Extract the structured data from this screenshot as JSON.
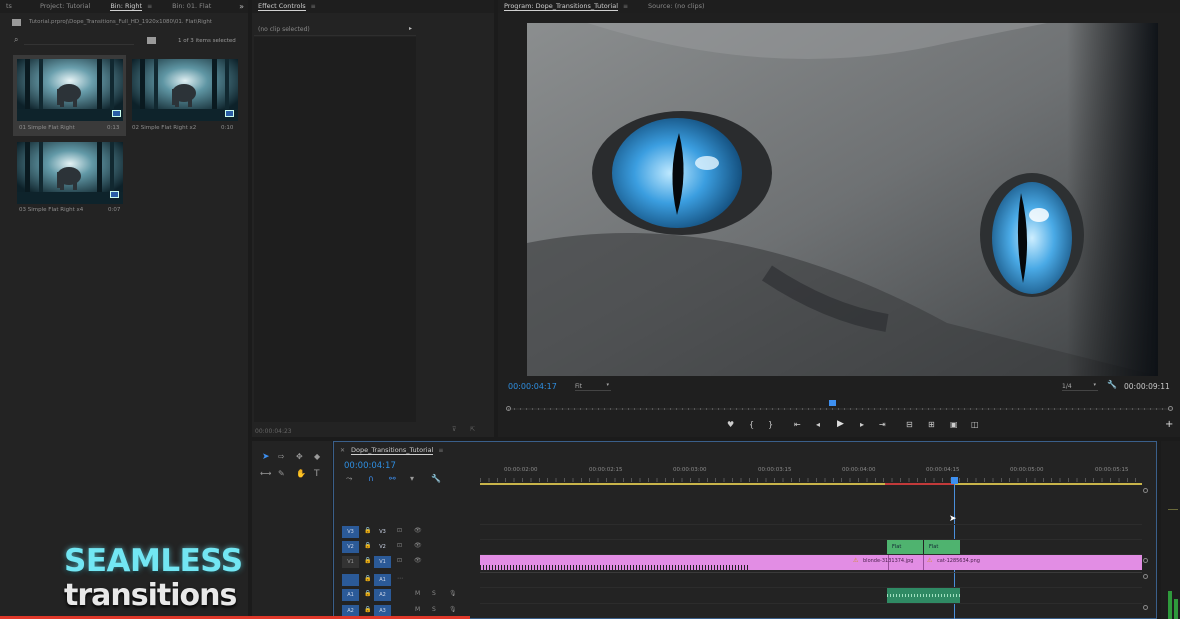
{
  "project_panel": {
    "tabs": [
      {
        "label": "ts"
      },
      {
        "label": "Project: Tutorial"
      },
      {
        "label": "Bin: Right"
      },
      {
        "label": "Bin: 01. Flat"
      }
    ],
    "overflow_icon": "double-chevron-right",
    "path": "Tutorial.prproj\\Dope_Transitions_Full_HD_1920x1080\\01. Flat\\Right",
    "selection_count": "1 of 3 items selected",
    "clips": [
      {
        "name": "01 Simple Flat Right",
        "duration": "0:13"
      },
      {
        "name": "02 Simple Flat Right x2",
        "duration": "0:10"
      },
      {
        "name": "03 Simple Flat Right x4",
        "duration": "0:07"
      }
    ]
  },
  "effect_controls": {
    "tab": "Effect Controls",
    "status": "(no clip selected)",
    "timecode": "00:00:04:23"
  },
  "program_monitor": {
    "tab_program": "Program: Dope_Transitions_Tutorial",
    "tab_source": "Source: (no clips)",
    "current_time": "00:00:04:17",
    "fit": "Fit",
    "resolution": "1/4",
    "duration": "00:00:09:11"
  },
  "timeline": {
    "tab": "Dope_Transitions_Tutorial",
    "current_time": "00:00:04:17",
    "ruler": [
      "00:00:02:00",
      "00:00:02:15",
      "00:00:03:00",
      "00:00:03:15",
      "00:00:04:00",
      "00:00:04:15",
      "00:00:05:00",
      "00:00:05:15"
    ],
    "tracks": [
      {
        "src": "V3",
        "name": "V3"
      },
      {
        "src": "V2",
        "name": "V2"
      },
      {
        "src": "V1",
        "name": "V1"
      },
      {
        "src": "",
        "name": "A1"
      },
      {
        "src": "A1",
        "name": "A2"
      },
      {
        "src": "A2",
        "name": "A3"
      }
    ],
    "track_flags": [
      "M",
      "S"
    ],
    "fx_clip_labels": [
      "Flat",
      "Flat"
    ],
    "v1_clip_labels": [
      "blonde-3131374.jpg",
      "cat-1285634.png"
    ]
  },
  "overlay": {
    "line1": "SEAMLESS",
    "line2": "transitions"
  },
  "colors": {
    "accent_blue": "#2e8ee0",
    "clip_pink": "#e28de4",
    "clip_green": "#4fb36f",
    "overlay_cyan": "#72e6f3"
  }
}
